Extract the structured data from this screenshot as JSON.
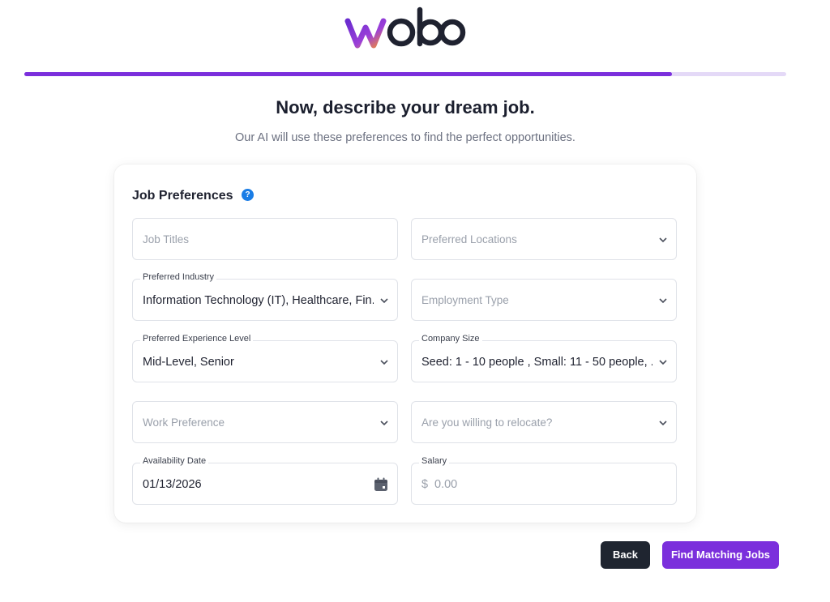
{
  "brand": {
    "logo_text": "wobo",
    "accent": "#7b2fdc"
  },
  "progress": {
    "value_percent": 85
  },
  "header": {
    "title": "Now, describe your dream job.",
    "subtitle": "Our AI will use these preferences to find the perfect opportunities."
  },
  "card": {
    "title": "Job Preferences",
    "help_icon": "question-circle-icon",
    "help_glyph": "?"
  },
  "fields": {
    "job_titles": {
      "placeholder": "Job Titles"
    },
    "preferred_locations": {
      "placeholder": "Preferred Locations"
    },
    "preferred_industry": {
      "label": "Preferred Industry",
      "value": "Information Technology (IT), Healthcare, Fin..."
    },
    "employment_type": {
      "placeholder": "Employment Type"
    },
    "experience_level": {
      "label": "Preferred Experience Level",
      "value": "Mid-Level, Senior"
    },
    "company_size": {
      "label": "Company Size",
      "value": "Seed: 1 - 10 people , Small: 11 - 50 people, ..."
    },
    "work_preference": {
      "placeholder": "Work Preference"
    },
    "relocate": {
      "placeholder": "Are you willing to relocate?"
    },
    "availability_date": {
      "label": "Availability Date",
      "value": "01/13/2026"
    },
    "salary": {
      "label": "Salary",
      "currency": "$",
      "placeholder": "0.00"
    }
  },
  "actions": {
    "back_label": "Back",
    "find_label": "Find Matching Jobs"
  }
}
